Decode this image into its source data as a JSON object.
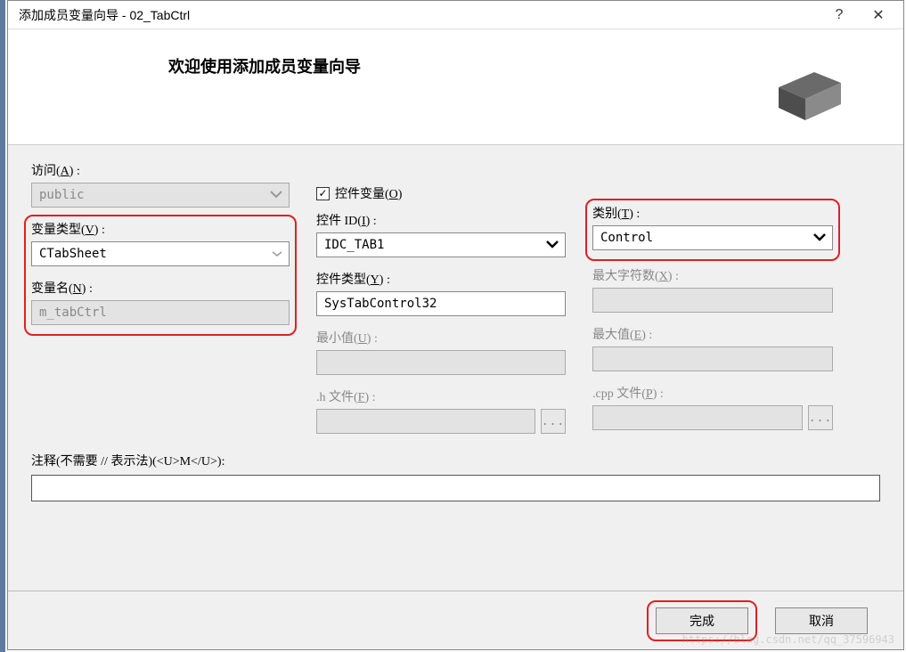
{
  "titlebar": {
    "title": "添加成员变量向导 - 02_TabCtrl",
    "help": "?",
    "close": "✕"
  },
  "header": {
    "heading": "欢迎使用添加成员变量向导"
  },
  "labels": {
    "access": "访问(",
    "access_key": "A",
    "access_suffix": ") :",
    "var_type": "变量类型(",
    "var_type_key": "V",
    "var_type_suffix": ") :",
    "var_name": "变量名(",
    "var_name_key": "N",
    "var_name_suffix": ") :",
    "control_var": "控件变量(",
    "control_var_key": "O",
    "control_var_suffix": ")",
    "control_id": "控件 ID(",
    "control_id_key": "I",
    "control_id_suffix": ") :",
    "control_type": "控件类型(",
    "control_type_key": "Y",
    "control_type_suffix": ") :",
    "min_val": "最小值(",
    "min_val_key": "U",
    "min_val_suffix": ") :",
    "h_file": ".h 文件(",
    "h_file_key": "F",
    "h_file_suffix": ") :",
    "category": "类别(",
    "category_key": "T",
    "category_suffix": ") :",
    "max_chars": "最大字符数(",
    "max_chars_key": "X",
    "max_chars_suffix": ") :",
    "max_val": "最大值(",
    "max_val_key": "E",
    "max_val_suffix": ") :",
    "cpp_file": ".cpp 文件(",
    "cpp_file_key": "P",
    "cpp_file_suffix": ") :",
    "comment": "注释(不需要 // 表示法)(<U>M</U>):"
  },
  "values": {
    "access": "public",
    "var_type": "CTabSheet",
    "var_name": "m_tabCtrl",
    "control_id": "IDC_TAB1",
    "control_type": "SysTabControl32",
    "category": "Control",
    "checked": "✓",
    "browse": "..."
  },
  "footer": {
    "finish": "完成",
    "cancel": "取消"
  },
  "watermark": "https://blog.csdn.net/qq_37596943"
}
